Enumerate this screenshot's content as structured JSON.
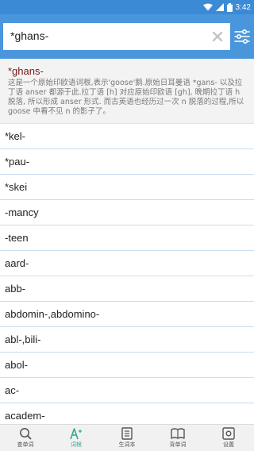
{
  "status_bar": {
    "time": "3:42"
  },
  "search": {
    "value": "*ghans-"
  },
  "entry": {
    "word": "*ghans-",
    "definition": "这是一个原始印欧语词根,表示'goose'鹅.原始日耳曼语 *gans- 以及拉丁语 anser 都源于此.拉丁语 [h] 对应原始印欧语 [gh], 晚期拉丁语 h 脱落, 所以形成 anser 形式. 而古英语也经历过一次 n 脱落的过程,所以 goose 中看不见 n 的影子了。"
  },
  "list": [
    "*kel-",
    "*pau-",
    "*skei",
    "-mancy",
    "-teen",
    "aard-",
    "abb-",
    "abdomin-,abdomino-",
    "abl-,bili-",
    "abol-",
    "ac-",
    "academ-"
  ],
  "nav": [
    {
      "label": "查单词",
      "icon": "search-icon",
      "active": false
    },
    {
      "label": "词根",
      "icon": "root-icon",
      "active": true
    },
    {
      "label": "生词本",
      "icon": "notebook-icon",
      "active": false
    },
    {
      "label": "背单词",
      "icon": "book-icon",
      "active": false
    },
    {
      "label": "设置",
      "icon": "settings-icon",
      "active": false
    }
  ],
  "colors": {
    "app_bar": "#4a96dc",
    "status_bar": "#3a8ad6",
    "accent": "#39a88f",
    "entry_word": "#7a1818"
  }
}
